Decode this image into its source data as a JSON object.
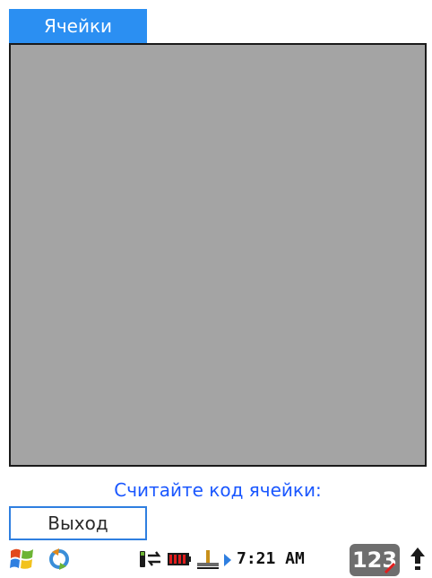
{
  "header": {
    "tab_label": "Ячейки"
  },
  "main": {
    "prompt_text": "Считайте код ячейки:"
  },
  "toolbar": {
    "exit_label": "Выход"
  },
  "taskbar": {
    "time": "7:21 AM",
    "input_mode": "123",
    "icons": [
      "start-icon",
      "sync-icon",
      "signal-icon",
      "battery-icon",
      "network-icon",
      "arrow-icon",
      "input-panel-icon",
      "up-arrow-icon"
    ]
  },
  "colors": {
    "tab_bg": "#2b8ff2",
    "panel_bg": "#a4a4a4",
    "prompt": "#1a57ff",
    "button_border": "#2f7fe0"
  }
}
